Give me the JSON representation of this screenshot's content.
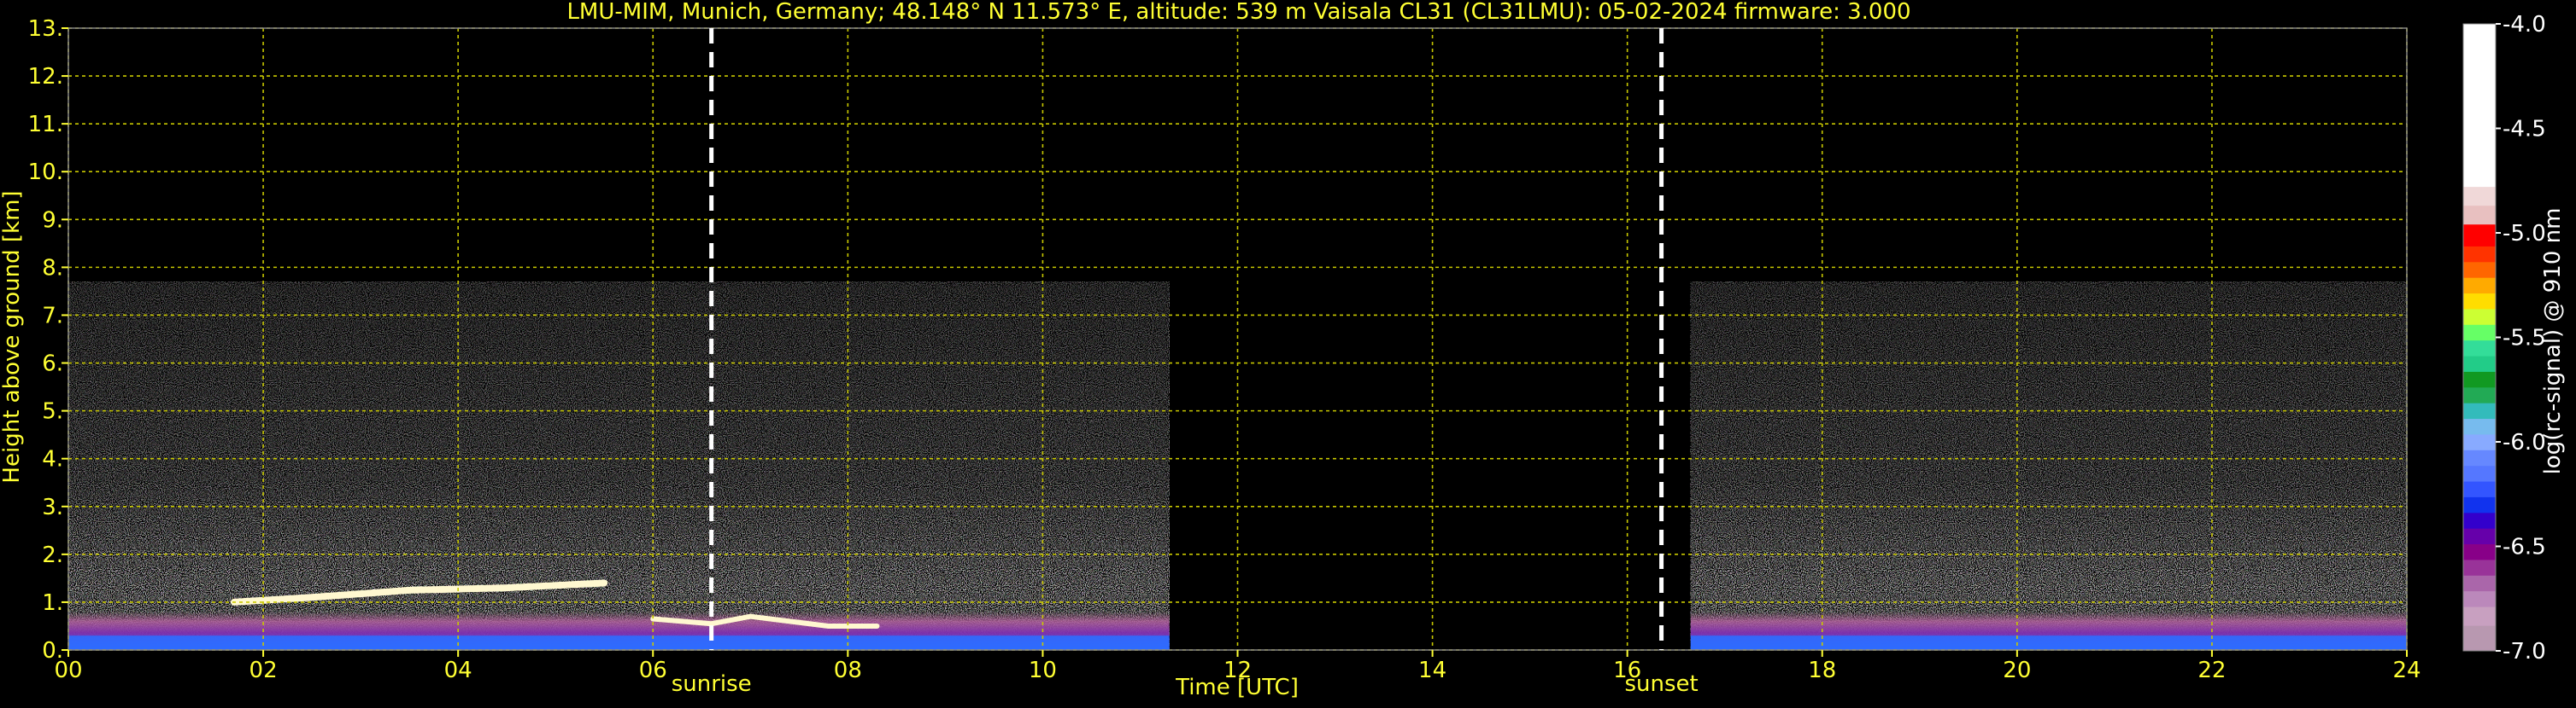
{
  "header": {
    "title": "LMU-MIM, Munich, Germany; 48.148° N 11.573° E, altitude: 539 m    Vaisala CL31 (CL31LMU): 05-02-2024    firmware: 3.000"
  },
  "chart_data": {
    "type": "heatmap",
    "title": "LMU-MIM, Munich, Germany; 48.148° N 11.573° E, altitude: 539 m    Vaisala CL31 (CL31LMU): 05-02-2024    firmware: 3.000",
    "xlabel": "Time [UTC]",
    "ylabel": "Height above ground [km]",
    "xlim": [
      0,
      24
    ],
    "ylim": [
      0,
      13
    ],
    "x_ticks": [
      "00",
      "02",
      "04",
      "06",
      "08",
      "10",
      "12",
      "14",
      "16",
      "18",
      "20",
      "22",
      "24"
    ],
    "y_ticks": [
      "0.",
      "1.",
      "2.",
      "3.",
      "4.",
      "5.",
      "6.",
      "7.",
      "8.",
      "9.",
      "10.",
      "11.",
      "12.",
      "13."
    ],
    "grid": true,
    "data_segments": [
      {
        "x_start": 0.0,
        "x_end": 11.3,
        "max_height": 7.7
      },
      {
        "x_start": 16.65,
        "x_end": 24.0,
        "max_height": 7.7
      }
    ],
    "cloud_layer": [
      {
        "x": 1.7,
        "y": 1.0
      },
      {
        "x": 2.5,
        "y": 1.1
      },
      {
        "x": 3.5,
        "y": 1.25
      },
      {
        "x": 4.5,
        "y": 1.3
      },
      {
        "x": 5.5,
        "y": 1.4
      },
      {
        "x": 6.0,
        "y": 0.65
      },
      {
        "x": 6.6,
        "y": 0.55
      },
      {
        "x": 7.0,
        "y": 0.7
      },
      {
        "x": 7.8,
        "y": 0.5
      },
      {
        "x": 8.3,
        "y": 0.5
      }
    ],
    "events": [
      {
        "label": "sunrise",
        "x": 6.6
      },
      {
        "label": "sunset",
        "x": 16.35
      }
    ],
    "colorbar": {
      "label": "log(rc-signal) @ 910 nm",
      "range": [
        -7.0,
        -4.0
      ],
      "ticks": [
        "-4.0",
        "-4.5",
        "-5.0",
        "-5.5",
        "-6.0",
        "-6.5",
        "-7.0"
      ]
    },
    "colors": {
      "text": "#ffff33",
      "grid": "#c8c800",
      "background": "#000000",
      "event_line": "#ffffff"
    }
  }
}
